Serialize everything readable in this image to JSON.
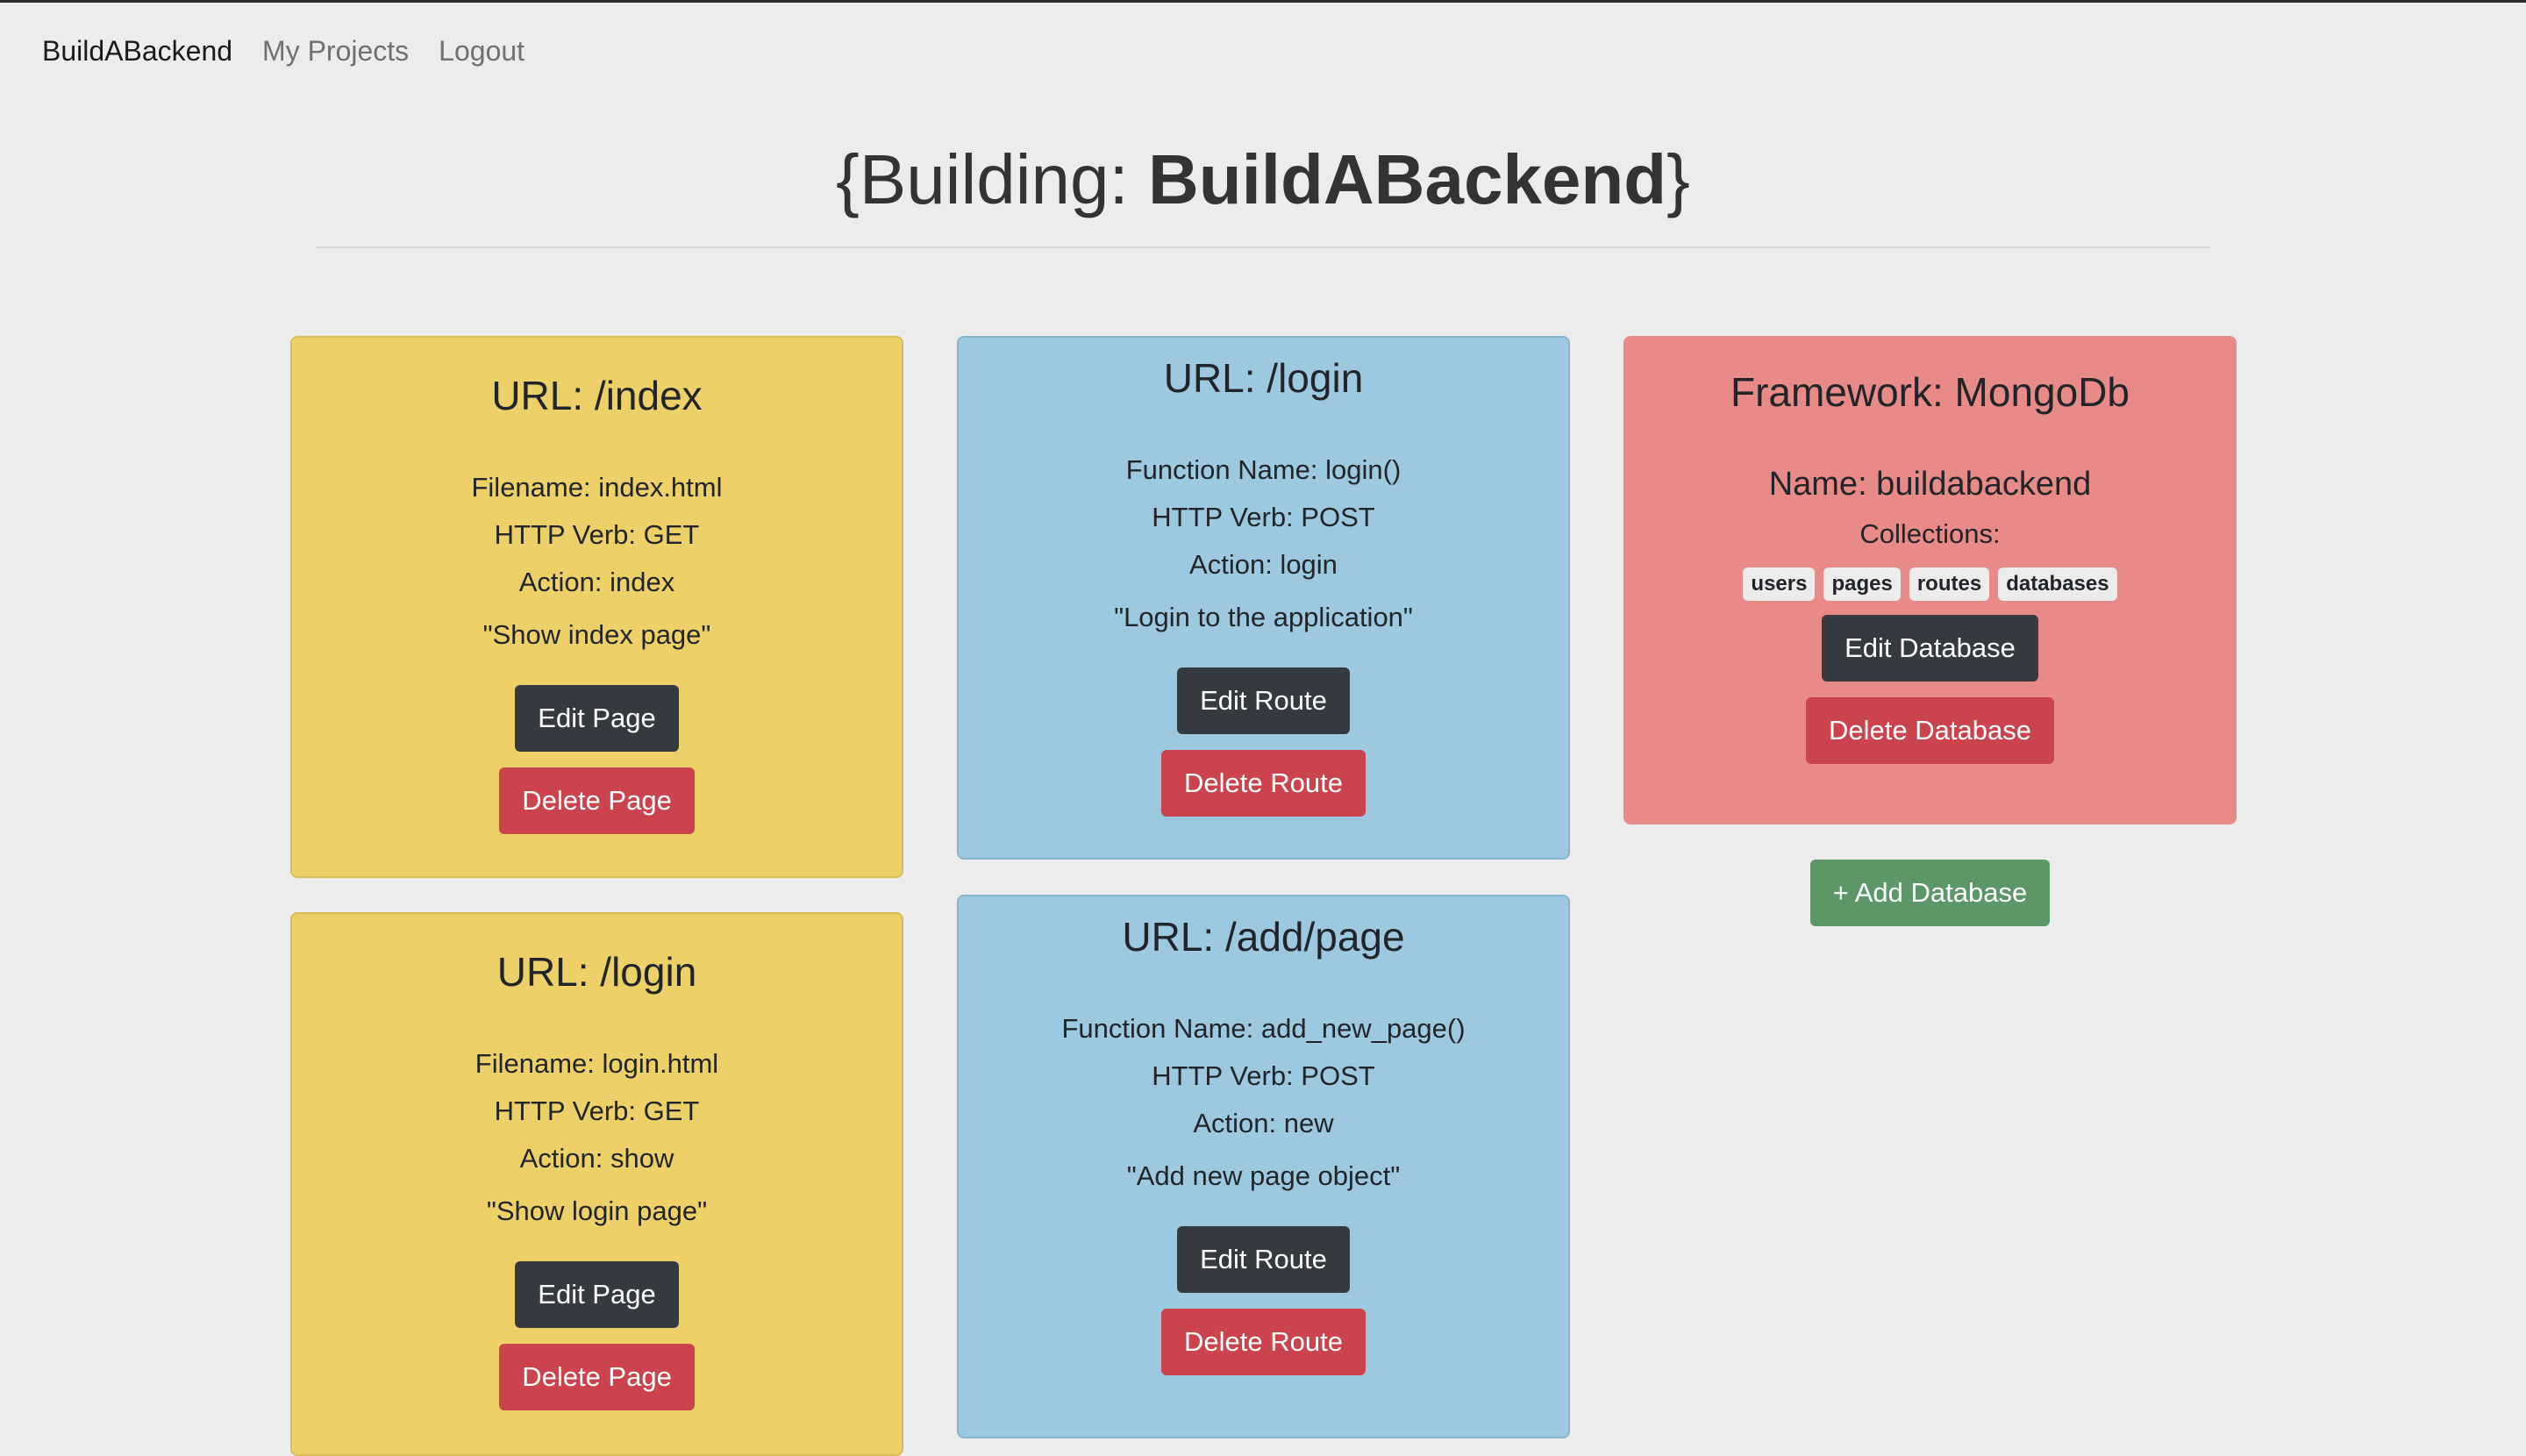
{
  "nav": {
    "brand": "BuildABackend",
    "links": [
      "My Projects",
      "Logout"
    ]
  },
  "header": {
    "prefix": "{Building: ",
    "project": "BuildABackend",
    "suffix": "}"
  },
  "pages": [
    {
      "title": "URL: /index",
      "filename": "Filename: index.html",
      "verb": "HTTP Verb: GET",
      "action": "Action: index",
      "description": "\"Show index page\"",
      "edit_label": "Edit Page",
      "delete_label": "Delete Page"
    },
    {
      "title": "URL: /login",
      "filename": "Filename: login.html",
      "verb": "HTTP Verb: GET",
      "action": "Action: show",
      "description": "\"Show login page\"",
      "edit_label": "Edit Page",
      "delete_label": "Delete Page"
    }
  ],
  "routes": [
    {
      "title": "URL: /login",
      "function": "Function Name: login()",
      "verb": "HTTP Verb: POST",
      "action": "Action: login",
      "description": "\"Login to the application\"",
      "edit_label": "Edit Route",
      "delete_label": "Delete Route"
    },
    {
      "title": "URL: /add/page",
      "function": "Function Name: add_new_page()",
      "verb": "HTTP Verb: POST",
      "action": "Action: new",
      "description": "\"Add new page object\"",
      "edit_label": "Edit Route",
      "delete_label": "Delete Route"
    }
  ],
  "database": {
    "framework": "Framework: MongoDb",
    "name": "Name: buildabackend",
    "collections_label": "Collections:",
    "collections": [
      "users",
      "pages",
      "routes",
      "databases"
    ],
    "edit_label": "Edit Database",
    "delete_label": "Delete Database",
    "add_label": "+ Add Database"
  },
  "colors": {
    "page_card": "#edd168",
    "route_card": "#9dc9e0",
    "db_card": "#e88b88",
    "dark_button": "#343a40",
    "danger_button": "#cb444d",
    "success_button": "#5c9768",
    "background": "#ececec"
  }
}
